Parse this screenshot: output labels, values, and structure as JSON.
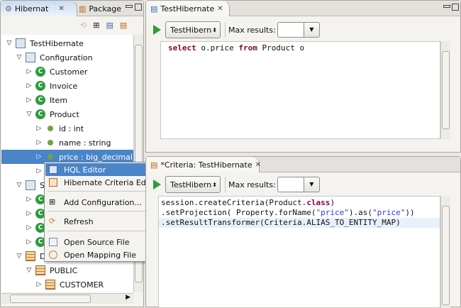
{
  "left_panel": {
    "tabs": [
      {
        "label": "Hibernat",
        "icon": "hibernate-icon",
        "active": true
      },
      {
        "label": "Package",
        "icon": "package-icon"
      }
    ],
    "tree": [
      {
        "label": "TestHibernate",
        "depth": 0,
        "expanded": true,
        "icon": "project-config-icon"
      },
      {
        "label": "Configuration",
        "depth": 1,
        "expanded": true,
        "icon": "configuration-icon"
      },
      {
        "label": "Customer",
        "depth": 2,
        "expanded": false,
        "icon": "class-icon"
      },
      {
        "label": "Invoice",
        "depth": 2,
        "expanded": false,
        "icon": "class-icon"
      },
      {
        "label": "Item",
        "depth": 2,
        "expanded": false,
        "icon": "class-icon"
      },
      {
        "label": "Product",
        "depth": 2,
        "expanded": true,
        "icon": "class-icon"
      },
      {
        "label": "id : int",
        "depth": 3,
        "icon": "id-property-icon"
      },
      {
        "label": "name : string",
        "depth": 3,
        "icon": "property-icon"
      },
      {
        "label": "price : big_decimal",
        "depth": 3,
        "icon": "property-icon",
        "selected": true
      },
      {
        "label": "",
        "depth": 3,
        "icon": ""
      },
      {
        "label": "Se",
        "depth": 1,
        "expanded": true,
        "icon": "session-factory-icon"
      },
      {
        "label": "",
        "depth": 2,
        "icon": "class-icon"
      },
      {
        "label": "",
        "depth": 2,
        "icon": "class-icon"
      },
      {
        "label": "",
        "depth": 2,
        "icon": "class-icon"
      },
      {
        "label": "",
        "depth": 2,
        "icon": "class-icon"
      },
      {
        "label": "Da",
        "depth": 1,
        "expanded": true,
        "icon": "database-icon"
      },
      {
        "label": "PUBLIC",
        "depth": 2,
        "expanded": true,
        "icon": "schema-icon"
      },
      {
        "label": "CUSTOMER",
        "depth": 3,
        "icon": "table-icon"
      }
    ]
  },
  "context_menu": {
    "items": [
      {
        "label": "HQL Editor",
        "icon": "hql-editor-icon",
        "highlighted": true
      },
      {
        "label": "Hibernate Criteria Editor",
        "icon": "criteria-editor-icon"
      },
      {
        "label": "Add Configuration...",
        "icon": "add-icon"
      },
      {
        "label": "Refresh",
        "icon": "refresh-icon"
      },
      {
        "label": "Open Source File",
        "icon": "java-file-icon"
      },
      {
        "label": "Open Mapping File",
        "icon": "mapping-file-icon"
      }
    ]
  },
  "hql_editor": {
    "tab_label": "TestHibernate",
    "config": "TestHibernate",
    "max_results_label": "Max results:",
    "max_results_value": "",
    "code": [
      {
        "kw": "select",
        "rest": " o.price "
      },
      {
        "kw": "from",
        "rest": " Product o"
      }
    ]
  },
  "criteria_editor": {
    "tab_label": "*Criteria: TestHibernate",
    "config": "TestHibernate",
    "max_results_label": "Max results:",
    "max_results_value": "",
    "line1_a": "session.createCriteria(Product.",
    "line1_kw": "class",
    "line1_b": ")",
    "line2_a": ".setProjection( Property.forName(",
    "line2_s1": "\"price\"",
    "line2_b": ").as(",
    "line2_s2": "\"price\"",
    "line2_c": "))",
    "line3": ".setResultTransformer(Criteria.ALIAS_TO_ENTITY_MAP)"
  }
}
